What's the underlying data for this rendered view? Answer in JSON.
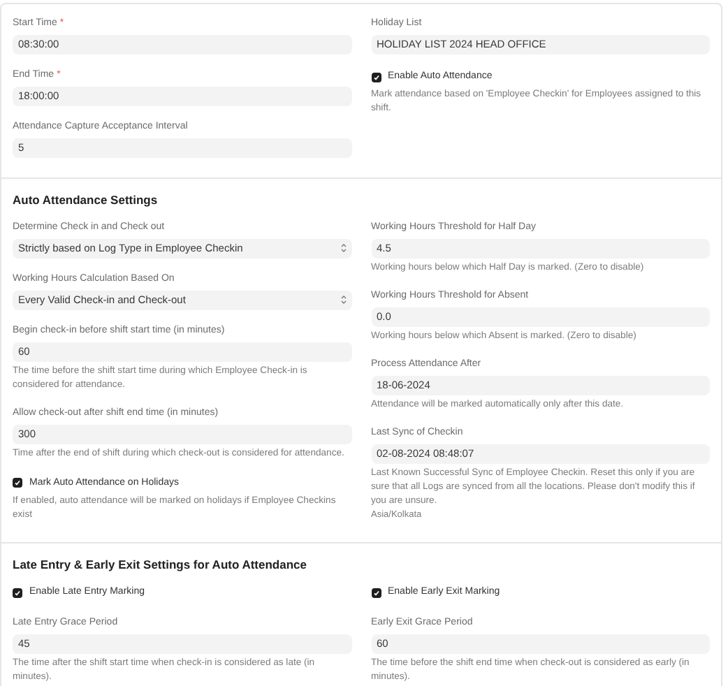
{
  "sections": [
    {
      "columns": [
        [
          {
            "kind": "input",
            "label": "Start Time",
            "required_marker": "*",
            "value": "08:30:00"
          },
          {
            "kind": "input",
            "label": "End Time",
            "required_marker": "*",
            "value": "18:00:00"
          },
          {
            "kind": "input",
            "label": "Attendance Capture Acceptance Interval",
            "value": "5"
          }
        ],
        [
          {
            "kind": "input",
            "label": "Holiday List",
            "value": "HOLIDAY LIST 2024 HEAD OFFICE"
          },
          {
            "kind": "checkbox",
            "label": "Enable Auto Attendance",
            "checked": true,
            "description": "Mark attendance based on 'Employee Checkin' for Employees assigned to this shift."
          }
        ]
      ]
    },
    {
      "title": "Auto Attendance Settings",
      "columns": [
        [
          {
            "kind": "select",
            "label": "Determine Check in and Check out",
            "value": "Strictly based on Log Type in Employee Checkin"
          },
          {
            "kind": "select",
            "label": "Working Hours Calculation Based On",
            "value": "Every Valid Check-in and Check-out"
          },
          {
            "kind": "input",
            "label": "Begin check-in before shift start time (in minutes)",
            "value": "60",
            "description": "The time before the shift start time during which Employee Check-in is considered for attendance."
          },
          {
            "kind": "input",
            "label": "Allow check-out after shift end time (in minutes)",
            "value": "300",
            "description": "Time after the end of shift during which check-out is considered for attendance."
          },
          {
            "kind": "checkbox",
            "label": "Mark Auto Attendance on Holidays",
            "checked": true,
            "description": "If enabled, auto attendance will be marked on holidays if Employee Checkins exist"
          }
        ],
        [
          {
            "kind": "input",
            "label": "Working Hours Threshold for Half Day",
            "value": "4.5",
            "description": "Working hours below which Half Day is marked. (Zero to disable)"
          },
          {
            "kind": "input",
            "label": "Working Hours Threshold for Absent",
            "value": "0.0",
            "description": "Working hours below which Absent is marked. (Zero to disable)"
          },
          {
            "kind": "input",
            "label": "Process Attendance After",
            "value": "18-06-2024",
            "description": "Attendance will be marked automatically only after this date."
          },
          {
            "kind": "input",
            "label": "Last Sync of Checkin",
            "value": "02-08-2024 08:48:07",
            "description": "Last Known Successful Sync of Employee Checkin. Reset this only if you are sure that all Logs are synced from all the locations. Please don't modify this if you are unsure.",
            "note": "Asia/Kolkata"
          }
        ]
      ]
    },
    {
      "title": "Late Entry & Early Exit Settings for Auto Attendance",
      "columns": [
        [
          {
            "kind": "checkbox",
            "label": "Enable Late Entry Marking",
            "checked": true
          },
          {
            "kind": "input",
            "label": "Late Entry Grace Period",
            "value": "45",
            "description": "The time after the shift start time when check-in is considered as late (in minutes)."
          }
        ],
        [
          {
            "kind": "checkbox",
            "label": "Enable Early Exit Marking",
            "checked": true
          },
          {
            "kind": "input",
            "label": "Early Exit Grace Period",
            "value": "60",
            "description": "The time before the shift end time when check-out is considered as early (in minutes)."
          }
        ]
      ]
    }
  ]
}
